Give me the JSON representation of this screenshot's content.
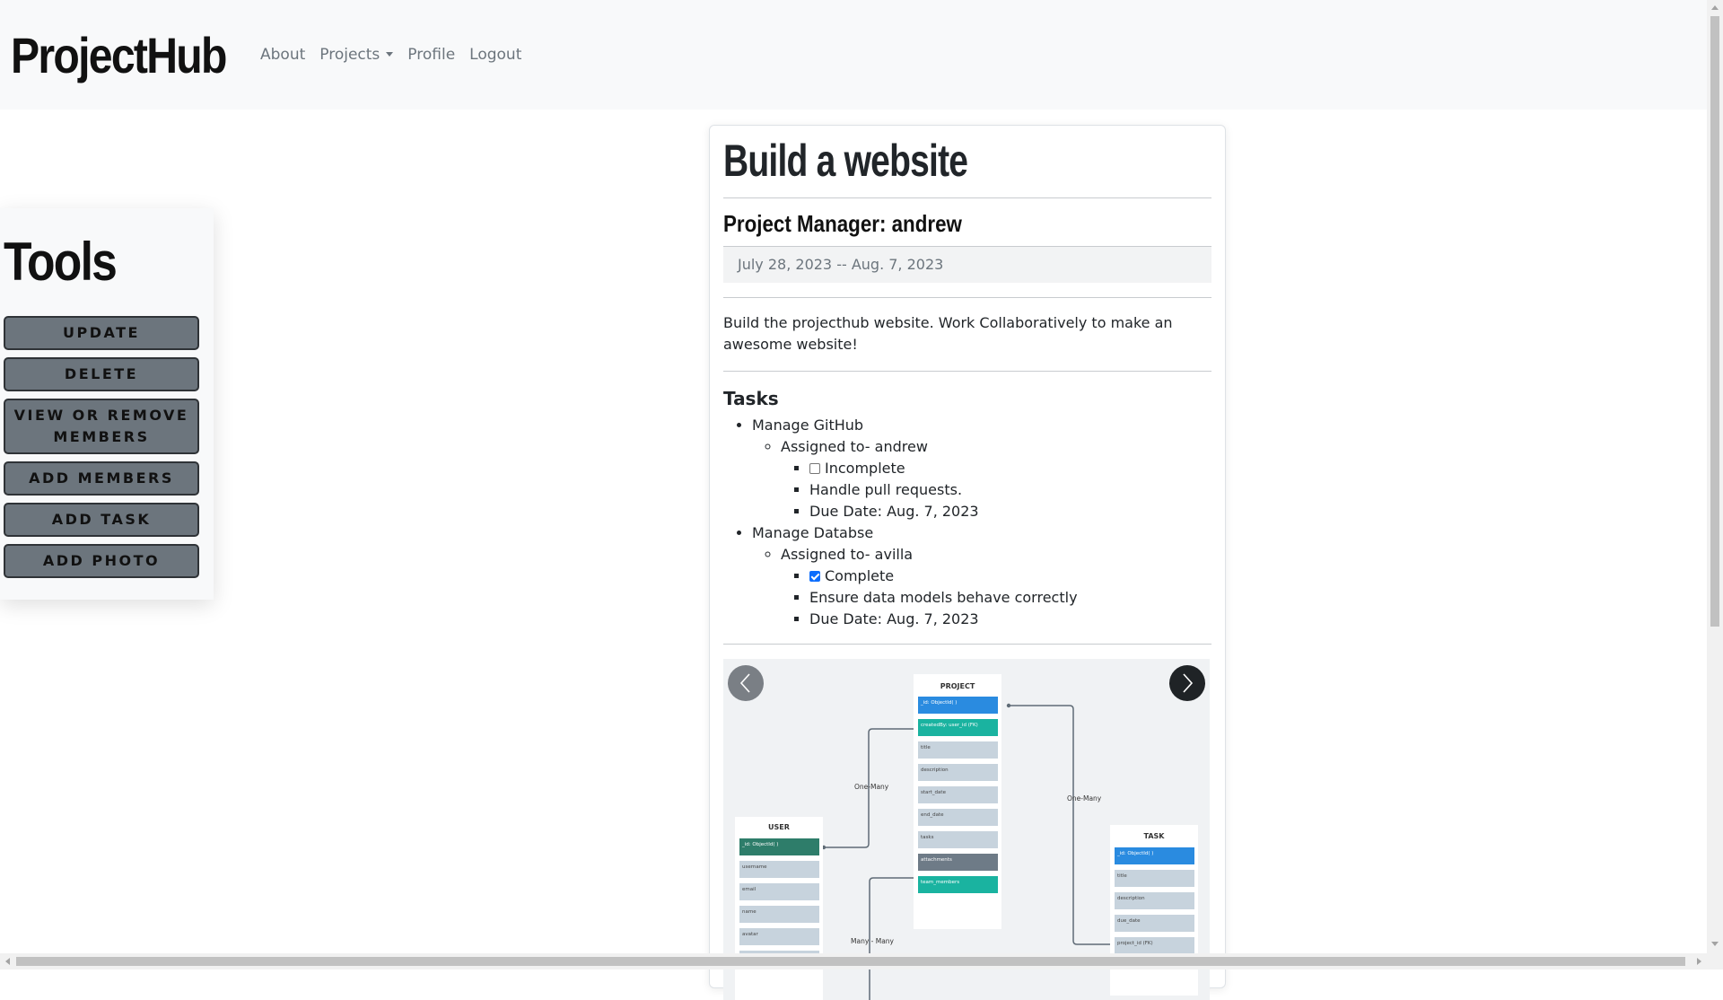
{
  "navbar": {
    "brand": "ProjectHub",
    "links": [
      {
        "label": "About"
      },
      {
        "label": "Projects",
        "dropdown": true
      },
      {
        "label": "Profile"
      },
      {
        "label": "Logout"
      }
    ]
  },
  "tools": {
    "title": "Tools",
    "buttons": [
      "UPDATE",
      "DELETE",
      "VIEW OR REMOVE MEMBERS",
      "ADD MEMBERS",
      "ADD TASK",
      "ADD PHOTO"
    ]
  },
  "project": {
    "title": "Build a website",
    "manager": "Project Manager: andrew",
    "dates": "July 28, 2023 -- Aug. 7, 2023",
    "description": "Build the projecthub website. Work Collaboratively to make an awesome website!",
    "tasks_heading": "Tasks",
    "tasks": [
      {
        "name": "Manage GitHub",
        "assigned": "Assigned to- andrew",
        "status": "Incomplete",
        "complete": false,
        "detail": "Handle pull requests.",
        "due": "Due Date: Aug. 7, 2023"
      },
      {
        "name": "Manage Databse",
        "assigned": "Assigned to- avilla",
        "status": "Complete",
        "complete": true,
        "detail": "Ensure data models behave correctly",
        "due": "Due Date: Aug. 7, 2023"
      }
    ]
  },
  "diagram": {
    "project": {
      "header": "PROJECT",
      "fields": [
        "_id: ObjectId( )",
        "createdBy: user_id (FK)",
        "title",
        "description",
        "start_date",
        "end_date",
        "tasks",
        "attachments",
        "team_members"
      ]
    },
    "user": {
      "header": "USER",
      "fields": [
        "_id: ObjectId( )",
        "username",
        "email",
        "name",
        "avatar"
      ]
    },
    "task": {
      "header": "TASK",
      "fields": [
        "_id: ObjectId( )",
        "title",
        "description",
        "due_date",
        "project_id (FK)"
      ]
    },
    "relations": [
      "One-Many",
      "One-Many",
      "Many - Many"
    ]
  },
  "colors": {
    "navbar_bg": "#f8f9fa",
    "button_bg": "#6c757d",
    "checkbox_checked": "#0d6efd",
    "field_blue": "#2a8be0",
    "field_teal": "#1ab3a0",
    "field_green": "#2e7d6a",
    "field_gray": "#c7d3dd",
    "field_dark": "#6e7b87"
  }
}
